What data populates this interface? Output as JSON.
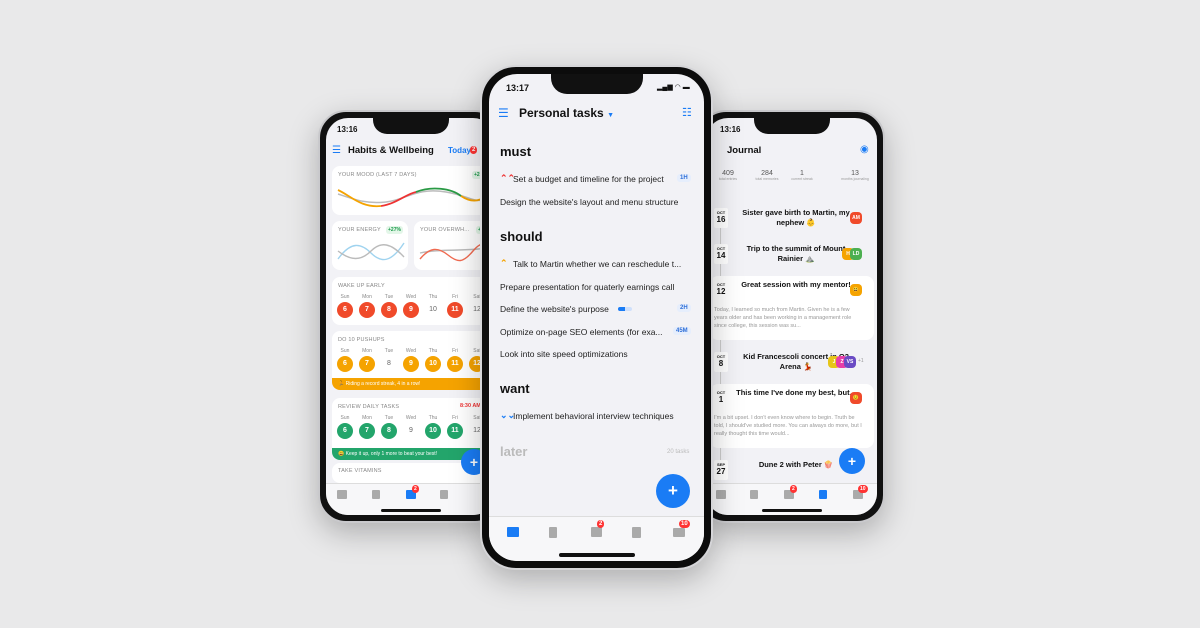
{
  "colors": {
    "accent": "#1a7cf5",
    "red": "#f04a2a",
    "orange": "#f5a300",
    "green": "#23a56b",
    "badge": "#f33333"
  },
  "left": {
    "time": "13:16",
    "title": "Habits & Wellbeing",
    "today": "Today",
    "today_badge": "2",
    "mood": {
      "label": "YOUR MOOD (LAST 7 DAYS)",
      "change": "+23%"
    },
    "energy": {
      "label": "YOUR ENERGY",
      "change": "+27%"
    },
    "overwhelm": {
      "label": "YOUR OVERWH...",
      "change": "+10"
    },
    "habits": [
      {
        "name": "WAKE UP EARLY",
        "color": "#f04a2a",
        "time": "",
        "days": [
          "Sun",
          "Mon",
          "Tue",
          "Wed",
          "Thu",
          "Fri",
          "Sat"
        ],
        "nums": [
          "6",
          "7",
          "8",
          "9",
          "10",
          "11",
          "12"
        ],
        "done": [
          true,
          true,
          true,
          true,
          false,
          true,
          false
        ],
        "banner": ""
      },
      {
        "name": "DO 10 PUSHUPS",
        "color": "#f5a300",
        "time": "",
        "days": [
          "Sun",
          "Mon",
          "Tue",
          "Wed",
          "Thu",
          "Fri",
          "Sat"
        ],
        "nums": [
          "6",
          "7",
          "8",
          "9",
          "10",
          "11",
          "12"
        ],
        "done": [
          true,
          true,
          false,
          true,
          true,
          true,
          true
        ],
        "banner": "🏃 Riding a record streak, 4 in a row!"
      },
      {
        "name": "REVIEW DAILY TASKS",
        "color": "#23a56b",
        "time": "8:30 AM",
        "days": [
          "Sun",
          "Mon",
          "Tue",
          "Wed",
          "Thu",
          "Fri",
          "Sat"
        ],
        "nums": [
          "6",
          "7",
          "8",
          "9",
          "10",
          "11",
          "12"
        ],
        "done": [
          true,
          true,
          true,
          false,
          true,
          true,
          false
        ],
        "banner": "😀 Keep it up, only 1 more to beat your best!"
      }
    ],
    "vitamins": "TAKE VITAMINS",
    "tab_badge": "2"
  },
  "middle": {
    "time": "13:17",
    "title": "Personal tasks",
    "sections": [
      {
        "name": "must",
        "tasks": [
          {
            "text": "Set a budget and timeline for the project",
            "prio": "high",
            "est": "1H"
          },
          {
            "text": "Design the website's layout and menu structure",
            "prio": "",
            "est": ""
          }
        ]
      },
      {
        "name": "should",
        "tasks": [
          {
            "text": "Talk to Martin whether we can reschedule t...",
            "prio": "medium",
            "est": ""
          },
          {
            "text": "Prepare presentation for quaterly earnings call",
            "prio": "",
            "est": ""
          },
          {
            "text": "Define the website's purpose",
            "prio": "",
            "est": "2H",
            "progress": 0.5
          },
          {
            "text": "Optimize on-page SEO elements (for exa...",
            "prio": "",
            "est": "45M"
          },
          {
            "text": "Look into site speed optimizations",
            "prio": "",
            "est": ""
          }
        ]
      },
      {
        "name": "want",
        "tasks": [
          {
            "text": "Implement behavioral interview techniques",
            "prio": "low",
            "est": ""
          }
        ]
      }
    ],
    "later": "later",
    "later_count": "20 tasks",
    "tab_badges": [
      "2",
      "10"
    ]
  },
  "right": {
    "time": "13:16",
    "title": "Journal",
    "stats": [
      {
        "v": "409",
        "l": "total entries"
      },
      {
        "v": "284",
        "l": "total memories"
      },
      {
        "v": "1",
        "l": "current streak"
      },
      {
        "v": "13",
        "l": "months journaling"
      }
    ],
    "entries": [
      {
        "m": "OCT",
        "d": "16",
        "title": "Sister gave birth to Martin, my nephew 👶",
        "body": "",
        "avatars": [
          {
            "t": "AM",
            "c": "#f04a2a"
          }
        ],
        "extra": ""
      },
      {
        "m": "OCT",
        "d": "14",
        "title": "Trip to the summit of Mount Rainier ⛰️",
        "body": "",
        "avatars": [
          {
            "t": "H",
            "c": "#f5a300"
          },
          {
            "t": "LD",
            "c": "#4caf50"
          }
        ],
        "extra": ""
      },
      {
        "m": "OCT",
        "d": "12",
        "title": "Great session with my mentor!",
        "body": "Today, I learned so much from Martin. Given he is a few years older and has been working in a management role since college, this session was su...",
        "avatars": [
          {
            "t": "😃",
            "c": "#f5a300"
          }
        ],
        "extra": ""
      },
      {
        "m": "OCT",
        "d": "8",
        "title": "Kid Francescoli concert in O2 Arena 💃",
        "body": "",
        "avatars": [
          {
            "t": "J",
            "c": "#e6c619"
          },
          {
            "t": "Z",
            "c": "#e83ea8"
          },
          {
            "t": "VS",
            "c": "#6a4bc4"
          }
        ],
        "extra": "+1"
      },
      {
        "m": "OCT",
        "d": "1",
        "title": "This time I've done my best, but...",
        "body": "I'm a bit upset. I don't even know where to begin. Truth be told, I should've studied more. You can always do more, but I really thought this time would...",
        "avatars": [
          {
            "t": "😟",
            "c": "#f04a2a"
          }
        ],
        "extra": ""
      },
      {
        "m": "SEP",
        "d": "27",
        "title": "Dune 2 with Peter 🍿",
        "body": "",
        "avatars": [],
        "extra": ""
      }
    ],
    "tab_badges": [
      "2",
      "10"
    ]
  }
}
